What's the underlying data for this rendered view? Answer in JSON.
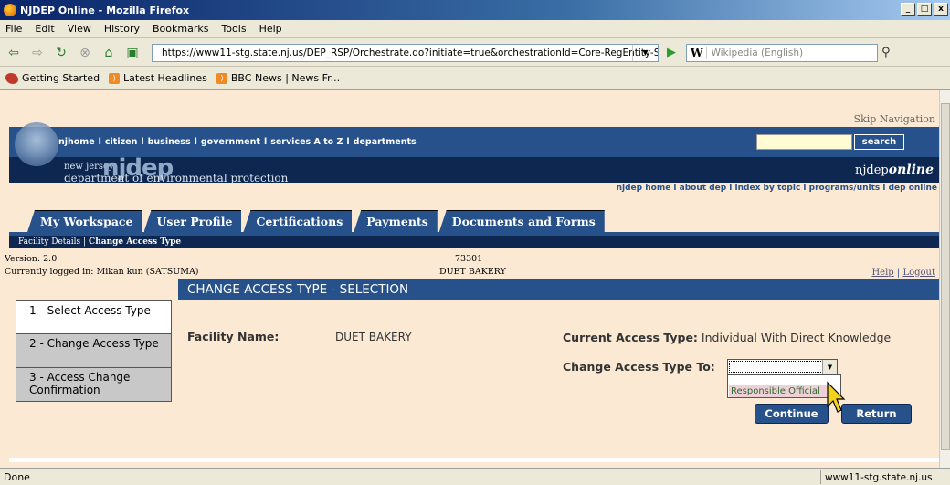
{
  "window": {
    "title": "NJDEP Online - Mozilla Firefox"
  },
  "menu": [
    "File",
    "Edit",
    "View",
    "History",
    "Bookmarks",
    "Tools",
    "Help"
  ],
  "toolbar": {
    "url": "https://www11-stg.state.nj.us/DEP_RSP/Orchestrate.do?initiate=true&orchestrationId=Core-RegEntity-S",
    "search_engine": "W",
    "search_placeholder": "Wikipedia (English)"
  },
  "bookmarks": [
    "Getting Started",
    "Latest Headlines",
    "BBC News | News Fr..."
  ],
  "page": {
    "skip_nav": "Skip Navigation",
    "topnav": [
      "njhome",
      "citizen",
      "business",
      "government",
      "services A to Z",
      "departments"
    ],
    "topnav_sep": "l",
    "search_button": "search",
    "logo_nj": "new jersey",
    "logo_njdep": "njdep",
    "logo_dept": "department of environmental protection",
    "online_brand_prefix": "njdep",
    "online_brand_suffix": "online",
    "subnav": "njdep home  l  about dep  l  index by topic  l  programs/units  l  dep online",
    "tabs": [
      "My Workspace",
      "User Profile",
      "Certifications",
      "Payments",
      "Documents and Forms"
    ],
    "breadcrumb_link": "Facility Details |",
    "breadcrumb_current": "Change Access Type",
    "version": "Version: 2.0",
    "logged_in": "Currently logged in: Mikan kun (SATSUMA)",
    "facility_id": "73301",
    "facility_name_top": "DUET BAKERY",
    "help": "Help",
    "help_sep": "|",
    "logout": "Logout",
    "section_title": "CHANGE ACCESS TYPE - SELECTION",
    "steps": [
      "1 - Select Access Type",
      "2 - Change Access Type",
      "3 - Access Change Confirmation"
    ],
    "facility_name_label": "Facility Name:",
    "facility_name_value": "DUET BAKERY",
    "current_access_label": "Current Access Type:",
    "current_access_value": "Individual With Direct Knowledge",
    "change_access_label": "Change Access Type To:",
    "dropdown_option": "Responsible Official",
    "continue": "Continue",
    "return": "Return"
  },
  "status": {
    "left": "Done",
    "right": "www11-stg.state.nj.us"
  }
}
